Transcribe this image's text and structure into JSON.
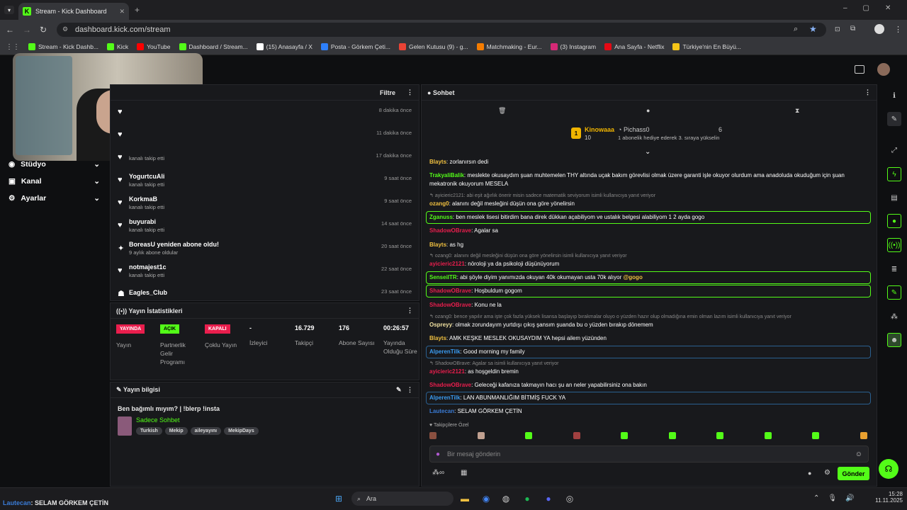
{
  "browser": {
    "tab_title": "Stream - Kick Dashboard",
    "url": "dashboard.kick.com/stream",
    "bookmarks": [
      "Stream - Kick Dashb...",
      "Kick",
      "YouTube",
      "Dashboard / Stream...",
      "(15) Anasayfa / X",
      "Posta - Görkem Çeti...",
      "Gelen Kutusu (9) - g...",
      "Matchmaking - Eur...",
      "(3) Instagram",
      "Ana Sayfa - Netflix",
      "Türkiye'nin En Büyü..."
    ]
  },
  "nav": {
    "items": [
      "Stüdyo",
      "Kanal",
      "Ayarlar"
    ]
  },
  "activity": {
    "filter_label": "Filtre",
    "items": [
      {
        "name": "",
        "sub": "",
        "time": "8 dakika önce"
      },
      {
        "name": "",
        "sub": "",
        "time": "11 dakika önce"
      },
      {
        "name": "",
        "sub": "kanalı takip etti",
        "time": "17 dakika önce"
      },
      {
        "name": "YogurtcuAli",
        "sub": "kanalı takip etti",
        "time": "9 saat önce"
      },
      {
        "name": "KorkmaB",
        "sub": "kanalı takip etti",
        "time": "9 saat önce"
      },
      {
        "name": "buyurabi",
        "sub": "kanalı takip etti",
        "time": "14 saat önce"
      },
      {
        "name": "BoreasU yeniden abone oldu!",
        "sub": "9 aylık abone oldular",
        "time": "20 saat önce"
      },
      {
        "name": "notmajest1c",
        "sub": "kanalı takip etti",
        "time": "22 saat önce"
      },
      {
        "name": "Eagles_Club",
        "sub": "",
        "time": "23 saat önce"
      }
    ]
  },
  "stats": {
    "title": "Yayın İstatistikleri",
    "live_badge": "YAYINDA",
    "live_label": "Yayın",
    "partner_badge": "AÇIK",
    "partner_label": "Partnerlik Gelir Programı",
    "multi_badge": "KAPALI",
    "multi_label": "Çoklu Yayın",
    "viewers_val": "-",
    "viewers_label": "İzleyici",
    "followers_val": "16.729",
    "followers_label": "Takipçi",
    "subs_val": "176",
    "subs_label": "Abone Sayısı",
    "uptime_val": "00:26:57",
    "uptime_label": "Yayında Olduğu Süre"
  },
  "stream_info": {
    "title": "Yayın bilgisi",
    "stream_title": "Ben bağımlı mıyım? | !blerp !insta",
    "category": "Sadece Sohbet",
    "tags": [
      "Turkish",
      "Mekip",
      "aileyayını",
      "MekipDays"
    ]
  },
  "chat": {
    "title": "Sohbet",
    "leader1_name": "Kinowaaa",
    "leader1_count": "10",
    "leader2_name": "Pichass0",
    "leader2_count": "6",
    "leader_note": "1 abonelik hediye ederek 3. sıraya yükselin",
    "followers_only": "Takipçilere Özel",
    "input_placeholder": "Bir mesaj gönderin",
    "send_label": "Gönder",
    "messages": [
      {
        "user": "Blayts",
        "text": ": zorlanırsın dedi"
      },
      {
        "user": "TrakyaliBalik",
        "text": ": meslekte okusaydım şuan muhtemelen THY altında uçak bakım görevlisi olmak üzere garanti işle okuyor olurdum ama anadoluda okuduğum için şuan mekatronik okuyorum MESELA"
      },
      {
        "reply": "ayicieric2121: abi eşit ağırlık önerir misin sadece matematik seviyorum isimli kullanıcıya yanıt veriyor"
      },
      {
        "user": "ozang0",
        "text": ": alanını değil mesleğini düşün ona göre yönelirsin"
      },
      {
        "user": "Zganuss",
        "text": ": ben meslek lisesi bitirdim bana direk dükkan açabiliyom ve ustalık belgesi alabiliyom 1 2 ayda gogo"
      },
      {
        "user": "ShadowOBrave",
        "text": ": Agalar sa"
      },
      {
        "user": "Blayts",
        "text": ": as hg"
      },
      {
        "reply": "ozang0: alanını değil mesleğini düşün ona göre yönelirsin isimli kullanıcıya yanıt veriyor"
      },
      {
        "user": "ayicieric2121",
        "text": ": nöroloji ya da psikoloji düşünüyorum"
      },
      {
        "user": "SenseiITR",
        "text": ": abi şöyle diyim yanımızda okuyan 40k okumayan usta 70k alıyor ",
        "mention": "@gogo"
      },
      {
        "user": "ShadowOBrave",
        "text": ": Hoşbuldum gogom"
      },
      {
        "user": "ShadowOBrave",
        "text": ": Konu ne la"
      },
      {
        "reply": "ozang0: bence yapılır ama işte çok fazla yüksek lisansa başlayıp bırakmalar oluyo o yüzden hazır olup olmadığına emin olman lazım isimli kullanıcıya yanıt veriyor"
      },
      {
        "user": "Ospreyy",
        "text": ": olmak zorundayım yurtdışı çıkış şansım şuanda bu o yüzden bırakıp dönemem"
      },
      {
        "user": "Blayts",
        "text": ": AMK KEŞKE MESLEK OKUSAYDIM YA hepsi ailem yüzünden"
      },
      {
        "user": "AlperenTilk",
        "text": ": Good morning my family"
      },
      {
        "reply": "ShadowOBrave: Agalar sa isimli kullanıcıya yanıt veriyor"
      },
      {
        "user": "ayicieric2121",
        "text": ": as hoşgeldin bremin"
      },
      {
        "user": "ShadowOBrave",
        "text": ": Geleceği kafanıza takmayın hacı şu an neler yapabilirsiniz ona bakın"
      },
      {
        "user": "AlperenTilk",
        "text": ": LAN ABUNMANLIĞIM BİTMİŞ FUCK YA"
      },
      {
        "user": "Lautecan",
        "text": ": SELAM GÖRKEM ÇETİN"
      }
    ]
  },
  "overlay_chat": {
    "user": "Lautecan",
    "text": ": SELAM GÖRKEM ÇETİN"
  },
  "taskbar": {
    "search": "Ara",
    "time": "15:28",
    "date": "11.11.2025"
  },
  "colors": {
    "kick_green": "#53fc18",
    "live_red": "#e91e4d"
  }
}
